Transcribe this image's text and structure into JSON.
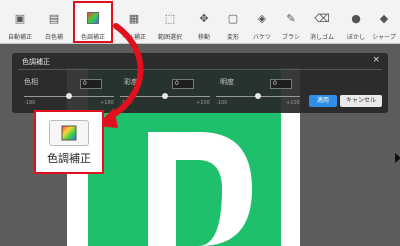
{
  "toolbar": {
    "tools": [
      {
        "label": "自動補正",
        "icon": "auto-correct-icon"
      },
      {
        "label": "白色補",
        "icon": "white-balance-icon"
      },
      {
        "label": "色調補正",
        "icon": "color-adjust-icon",
        "active": true
      },
      {
        "label": "ベル補正",
        "icon": "level-correct-icon"
      },
      {
        "label": "範囲選択",
        "icon": "select-range-icon"
      },
      {
        "label": "移動",
        "icon": "move-icon"
      },
      {
        "label": "変形",
        "icon": "transform-icon"
      },
      {
        "label": "バケツ",
        "icon": "bucket-icon"
      },
      {
        "label": "ブラシ",
        "icon": "brush-icon"
      },
      {
        "label": "消しゴム",
        "icon": "eraser-icon"
      },
      {
        "label": "ぼかし",
        "icon": "blur-icon"
      },
      {
        "label": "シャープ",
        "icon": "sharpen-icon"
      }
    ]
  },
  "panel": {
    "title": "色調補正",
    "close": "×",
    "params": [
      {
        "label": "色相",
        "value": "0",
        "min": "-180",
        "max": "+180",
        "level": 0.5
      },
      {
        "label": "彩度",
        "value": "0",
        "min": "-100",
        "max": "+100",
        "level": 0.5
      },
      {
        "label": "明度",
        "value": "0",
        "min": "-100",
        "max": "+100",
        "level": 0.5
      }
    ],
    "apply_label": "適用",
    "cancel_label": "キャンセル"
  },
  "callout": {
    "label": "色調補正",
    "icon": "color-adjust-icon"
  },
  "colors": {
    "highlight": "#e0101c",
    "apply_button": "#2f8fe8",
    "canvas_green": "#1ec06b"
  }
}
